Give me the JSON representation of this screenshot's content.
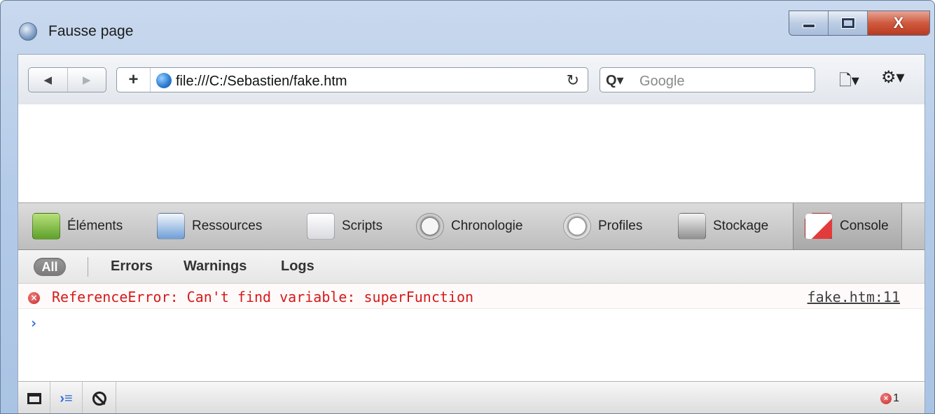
{
  "window": {
    "title": "Fausse page",
    "controls": {
      "minimize_icon": "minimize-icon",
      "maximize_icon": "maximize-icon",
      "close_label": "X"
    }
  },
  "toolbar": {
    "back_icon": "◀",
    "forward_icon": "▶",
    "new_tab_label": "+",
    "url": "file:///C:/Sebastien/fake.htm",
    "reload_icon": "↻",
    "search_icon": "Q▾",
    "search_placeholder": "Google",
    "page_menu_icon": "🗋▾",
    "settings_menu_icon": "⚙▾"
  },
  "inspector": {
    "tabs": [
      {
        "label": "Éléments",
        "icon": "elements-icon",
        "selected": false
      },
      {
        "label": "Ressources",
        "icon": "resources-icon",
        "selected": false
      },
      {
        "label": "Scripts",
        "icon": "scripts-icon",
        "selected": false
      },
      {
        "label": "Chronologie",
        "icon": "timeline-icon",
        "selected": false
      },
      {
        "label": "Profiles",
        "icon": "profiles-icon",
        "selected": false
      },
      {
        "label": "Stockage",
        "icon": "storage-icon",
        "selected": false
      },
      {
        "label": "Console",
        "icon": "console-icon",
        "selected": true
      }
    ],
    "scope_filters": {
      "all": "All",
      "errors": "Errors",
      "warnings": "Warnings",
      "logs": "Logs"
    },
    "messages": [
      {
        "level": "error",
        "text": "ReferenceError: Can't find variable: superFunction",
        "source": "fake.htm:11"
      }
    ],
    "prompt_symbol": "›",
    "statusbar": {
      "console_icon": "›≡",
      "error_count": "1"
    }
  },
  "colors": {
    "error_text": "#d41a1a",
    "prompt": "#2f6fd8",
    "frame": "#b4cbe8",
    "close_button": "#cf5a3f"
  }
}
